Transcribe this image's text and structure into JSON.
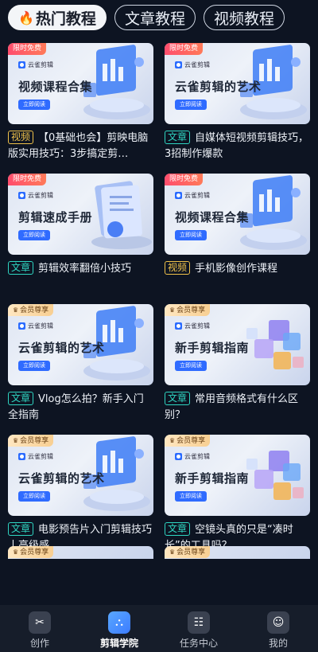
{
  "tabs": [
    {
      "label": "热门教程",
      "active": true
    },
    {
      "label": "文章教程",
      "active": false
    },
    {
      "label": "视频教程",
      "active": false
    }
  ],
  "brand_text": "云雀剪辑",
  "read_button": "立即阅读",
  "cards": [
    {
      "badge": "限时免费",
      "badge_kind": "free",
      "thumb_title": "视频课程合集",
      "illus": "chart",
      "type": "视频",
      "type_kind": "video",
      "title": "【0基础也会】剪映电脑版实用技巧：3步搞定剪…"
    },
    {
      "badge": "限时免费",
      "badge_kind": "free",
      "thumb_title": "云雀剪辑的艺术",
      "illus": "chart",
      "type": "文章",
      "type_kind": "article",
      "title": "自媒体短视频剪辑技巧，3招制作爆款"
    },
    {
      "badge": "限时免费",
      "badge_kind": "free",
      "thumb_title": "剪辑速成手册",
      "illus": "doc",
      "type": "文章",
      "type_kind": "article",
      "title": "剪辑效率翻倍小技巧"
    },
    {
      "badge": "限时免费",
      "badge_kind": "free",
      "thumb_title": "视频课程合集",
      "illus": "chart",
      "type": "视频",
      "type_kind": "video",
      "title": "手机影像创作课程"
    },
    {
      "badge": "会员尊享",
      "badge_kind": "vip",
      "thumb_title": "云雀剪辑的艺术",
      "illus": "chart",
      "type": "文章",
      "type_kind": "article",
      "title": "Vlog怎么拍？新手入门全指南"
    },
    {
      "badge": "会员尊享",
      "badge_kind": "vip",
      "thumb_title": "新手剪辑指南",
      "illus": "cubes",
      "type": "文章",
      "type_kind": "article",
      "title": "常用音频格式有什么区别？"
    },
    {
      "badge": "会员尊享",
      "badge_kind": "vip",
      "thumb_title": "云雀剪辑的艺术",
      "illus": "chart",
      "type": "文章",
      "type_kind": "article",
      "title": "电影预告片入门剪辑技巧丨高级感"
    },
    {
      "badge": "会员尊享",
      "badge_kind": "vip",
      "thumb_title": "新手剪辑指南",
      "illus": "cubes",
      "type": "文章",
      "type_kind": "article",
      "title": "空镜头真的只是“凑时长”的工具吗？"
    }
  ],
  "partial_cards": [
    {
      "badge": "会员尊享"
    },
    {
      "badge": "会员尊享"
    }
  ],
  "bottom_nav": [
    {
      "label": "创作",
      "icon": "scissors-icon",
      "glyph": "✂",
      "active": false
    },
    {
      "label": "剪辑学院",
      "icon": "academy-icon",
      "glyph": "⛬",
      "active": true
    },
    {
      "label": "任务中心",
      "icon": "task-icon",
      "glyph": "☷",
      "active": false
    },
    {
      "label": "我的",
      "icon": "profile-icon",
      "glyph": "☺",
      "active": false
    }
  ],
  "colors": {
    "background": "#0d1422",
    "free_badge": "#ff4d6d",
    "vip_badge": "#f8cf92",
    "video_tag": "#f0c24a",
    "article_tag": "#2fd6c2",
    "accent": "#3c7cff"
  }
}
